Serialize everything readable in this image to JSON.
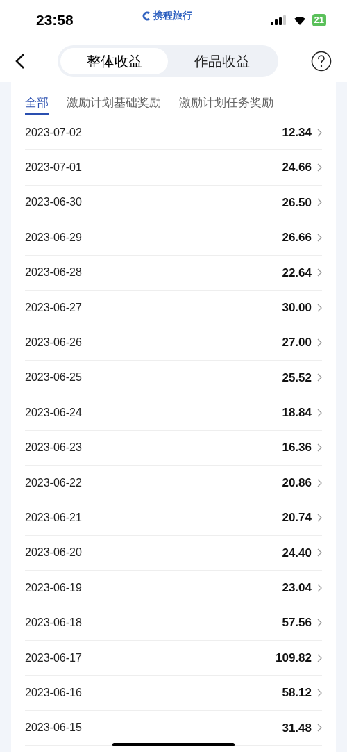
{
  "status_bar": {
    "time": "23:58",
    "app_label": "携程旅行",
    "battery": "21"
  },
  "header": {
    "segments": [
      {
        "label": "整体收益",
        "selected": true
      },
      {
        "label": "作品收益",
        "selected": false
      }
    ]
  },
  "filter_tabs": [
    {
      "label": "全部",
      "selected": true
    },
    {
      "label": "激励计划基础奖励",
      "selected": false
    },
    {
      "label": "激励计划任务奖励",
      "selected": false
    }
  ],
  "rows": [
    {
      "date": "2023-07-02",
      "amount": "12.34"
    },
    {
      "date": "2023-07-01",
      "amount": "24.66"
    },
    {
      "date": "2023-06-30",
      "amount": "26.50"
    },
    {
      "date": "2023-06-29",
      "amount": "26.66"
    },
    {
      "date": "2023-06-28",
      "amount": "22.64"
    },
    {
      "date": "2023-06-27",
      "amount": "30.00"
    },
    {
      "date": "2023-06-26",
      "amount": "27.00"
    },
    {
      "date": "2023-06-25",
      "amount": "25.52"
    },
    {
      "date": "2023-06-24",
      "amount": "18.84"
    },
    {
      "date": "2023-06-23",
      "amount": "16.36"
    },
    {
      "date": "2023-06-22",
      "amount": "20.86"
    },
    {
      "date": "2023-06-21",
      "amount": "20.74"
    },
    {
      "date": "2023-06-20",
      "amount": "24.40"
    },
    {
      "date": "2023-06-19",
      "amount": "23.04"
    },
    {
      "date": "2023-06-18",
      "amount": "57.56"
    },
    {
      "date": "2023-06-17",
      "amount": "109.82"
    },
    {
      "date": "2023-06-16",
      "amount": "58.12"
    },
    {
      "date": "2023-06-15",
      "amount": "31.48"
    }
  ]
}
